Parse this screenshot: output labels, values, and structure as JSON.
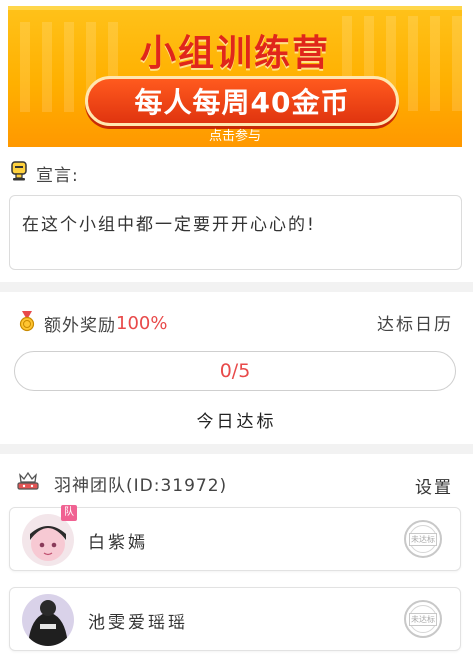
{
  "banner": {
    "title": "小组训练营",
    "subtitle": "每人每周40金币",
    "cta": "点击参与"
  },
  "declaration": {
    "label": "宣言:",
    "text": "在这个小组中都一定要开开心心的!"
  },
  "bonus": {
    "label": "额外奖励",
    "percent": "100%",
    "calendar_link": "达标日历"
  },
  "progress": {
    "value_text": "0/5",
    "fraction": 0.0
  },
  "today_button": "今日达标",
  "team": {
    "name": "羽神团队(ID:31972)",
    "settings_link": "设置",
    "members": [
      {
        "name": "白紫嫣",
        "captain_badge": "队",
        "status": "未达标"
      },
      {
        "name": "池雯爱瑶瑶",
        "status": "未达标"
      }
    ]
  },
  "colors": {
    "accent_red": "#e84a4a",
    "banner_orange": "#ffb000"
  }
}
